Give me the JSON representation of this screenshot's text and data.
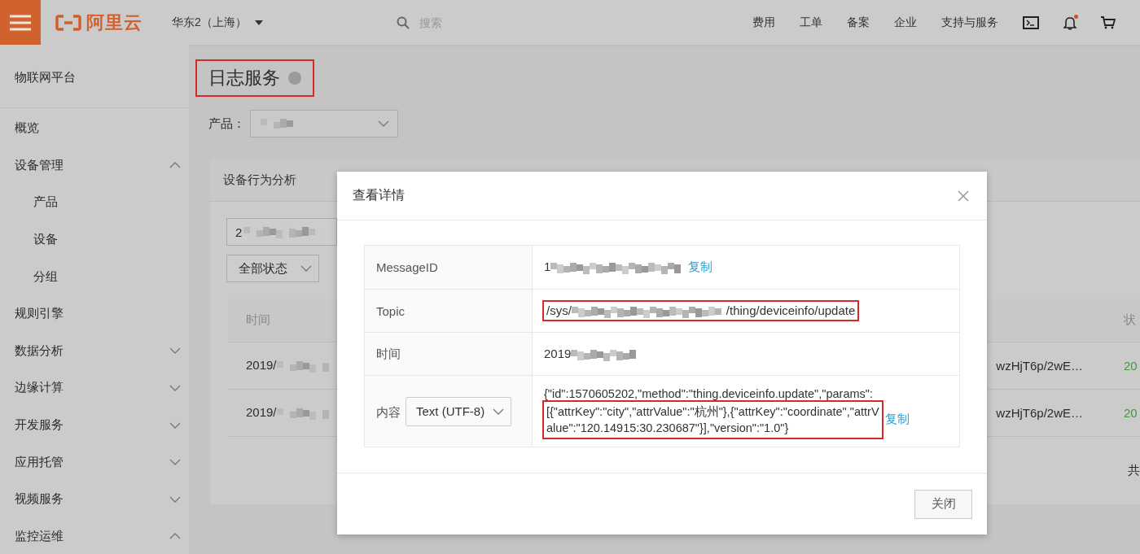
{
  "header": {
    "logo": "阿里云",
    "region": "华东2（上海）",
    "search": {
      "placeholder": "搜索"
    },
    "nav": [
      "费用",
      "工单",
      "备案",
      "企业",
      "支持与服务"
    ],
    "notification_dot": true
  },
  "sidebar": {
    "title": "物联网平台",
    "items": [
      {
        "label": "概览"
      },
      {
        "label": "设备管理",
        "expanded": true,
        "children": [
          {
            "label": "产品"
          },
          {
            "label": "设备"
          },
          {
            "label": "分组"
          }
        ]
      },
      {
        "label": "规则引擎"
      },
      {
        "label": "数据分析",
        "expanded": false
      },
      {
        "label": "边缘计算",
        "expanded": false
      },
      {
        "label": "开发服务",
        "expanded": false
      },
      {
        "label": "应用托管",
        "expanded": false
      },
      {
        "label": "视频服务",
        "expanded": false
      },
      {
        "label": "监控运维",
        "expanded": true
      }
    ]
  },
  "page": {
    "title": "日志服务",
    "title_highlighted": true,
    "product_label": "产品：",
    "tabs": [
      {
        "label": "设备行为分析",
        "selected": false
      }
    ],
    "filter_value": "2",
    "status_filter": "全部状态",
    "table": {
      "columns": [
        "时间",
        "状"
      ],
      "rows": [
        {
          "time": "2019/",
          "column_2": "wzHjT6p/2wE…",
          "status": "20"
        },
        {
          "time": "2019/",
          "column_2": "wzHjT6p/2wE…",
          "status": "20"
        }
      ]
    },
    "footer_text": "共"
  },
  "modal": {
    "title": "查看详情",
    "rows": [
      {
        "kind": "text",
        "label": "MessageID",
        "value_start": "1",
        "value_end": "",
        "copy": "复制",
        "highlighted": false
      },
      {
        "kind": "text",
        "label": "Topic",
        "value_start": "/sys/",
        "value_end": "/thing/deviceinfo/update",
        "highlighted": true
      },
      {
        "kind": "text",
        "label": "时间",
        "value_start": "2019",
        "value_end": "",
        "highlighted": false
      },
      {
        "kind": "content",
        "label": "内容",
        "format": "Text (UTF-8)",
        "lines": [
          {
            "text": "{\"id\":1570605202,\"method\":\"thing.deviceinfo.update\",\"params\":",
            "highlighted": false
          },
          {
            "text": "[{\"attrKey\":\"city\",\"attrValue\":\"杭州\"},{\"attrKey\":\"coordinate\",\"attrV",
            "highlighted": true
          },
          {
            "text": "alue\":\"120.14915:30.230687\"}],\"version\":\"1.0\"}",
            "highlighted": true
          }
        ],
        "copy": "复制"
      }
    ],
    "close_button": "关闭"
  }
}
